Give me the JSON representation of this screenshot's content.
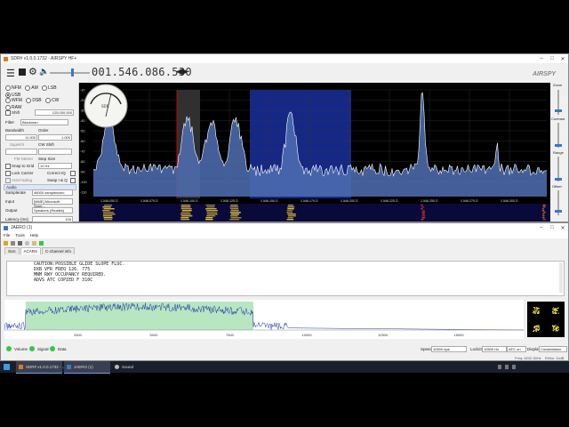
{
  "sdr": {
    "title": "SDR# v1.0.0.1732 - AIRSPY HF+",
    "frequency": "001.546.086.530",
    "brand": "AIRSPY",
    "modes_row1": [
      "NFM",
      "AM",
      "LSB",
      "USB"
    ],
    "modes_row2": [
      "WFM",
      "DSB",
      "CW",
      "RAW"
    ],
    "selected_mode": "USB",
    "shift_label": "Shift",
    "shift_value": "125.000.000",
    "filter_label": "Filter",
    "filter_value": "Blackman",
    "bandwidth_label": "Bandwidth",
    "bandwidth_value": "11.000",
    "order_label": "Order",
    "order_value": "1.000",
    "squelch_label": "Squelch",
    "cw_shift_label": "CW Shift",
    "fm_stereo_label": "FM Stereo",
    "step_size_label": "Step Size",
    "snap_label": "Snap to Grid",
    "snap_value": "10 Hz",
    "lock_carrier_label": "Lock Carrier",
    "correct_iq_label": "Correct IQ",
    "anti_fading_label": "Anti-Fading",
    "swap_iq_label": "Swap I & Q",
    "audio_section": "Audio",
    "samplerate_label": "Samplerate",
    "samplerate_value": "48000 samples/sec",
    "input_label": "Input",
    "input_value": "[MME] Microsoft Soun...",
    "output_label": "Output",
    "output_value": "Speakers (Realtek)",
    "latency_label": "Latency (ms)",
    "latency_value": "100",
    "y_ticks": [
      "-10",
      "-20",
      "-30",
      "-40",
      "-50",
      "-60",
      "-70",
      "-80",
      "-90",
      "-100",
      "-110"
    ],
    "x_ticks": [
      "1.546.050 D",
      "1.546.075 D",
      "1.546.100 D",
      "1.546.125 D",
      "1.546.150 D",
      "1.546.175 D",
      "1.546.200 D",
      "1.546.225 D",
      "1.546.250 D",
      "1.546.275 D",
      "1.546.300 D"
    ],
    "right_labels": [
      "Zoom",
      "Contrast",
      "Range",
      "Offset"
    ]
  },
  "jaero": {
    "title": "JAERO (1)",
    "menu": [
      "File",
      "Tools",
      "Help"
    ],
    "tabs": [
      "SUs",
      "ACARS",
      "C-channel info"
    ],
    "active_tab": "ACARS",
    "messages": [
      "CAUTION:POSSIBLE GLIDE SLOPE FLUC.",
      "DXB VFR FREQ 126. 775",
      "MNM RWY OCCUPANCY REQUIRED.",
      "ADVS ATC COPIED F 310C"
    ],
    "spectrum_ticks": [
      "2500",
      "5000",
      "7500",
      "10000",
      "12500",
      "15000",
      "17500",
      "20000",
      "22500"
    ],
    "status": [
      {
        "label": "Volume"
      },
      {
        "label": "Signal"
      },
      {
        "label": "Data"
      }
    ],
    "speed_label": "Speed",
    "speed_value": "10500 bps",
    "locking_label": "Locking",
    "locking_value": "10500 Hz",
    "afc_value": "AFC on",
    "display_label": "Display",
    "display_value": "Constellation",
    "freq_readout": "Freq: 6232.30Hz",
    "ebno_readout": "EbNo: 11dB"
  },
  "taskbar": {
    "apps": [
      "SDR# v1.0.0.1732 - ...",
      "JAERO (1)",
      "Sound"
    ]
  },
  "colors": {
    "spectrum_bg": "#000000",
    "signal_fill": "#4f6fb3",
    "highlight_band": "#1a2f9e",
    "jaero_band": "#b8e6c1",
    "taskbar": "#1a1f2c",
    "led_green": "#2ecc40"
  }
}
